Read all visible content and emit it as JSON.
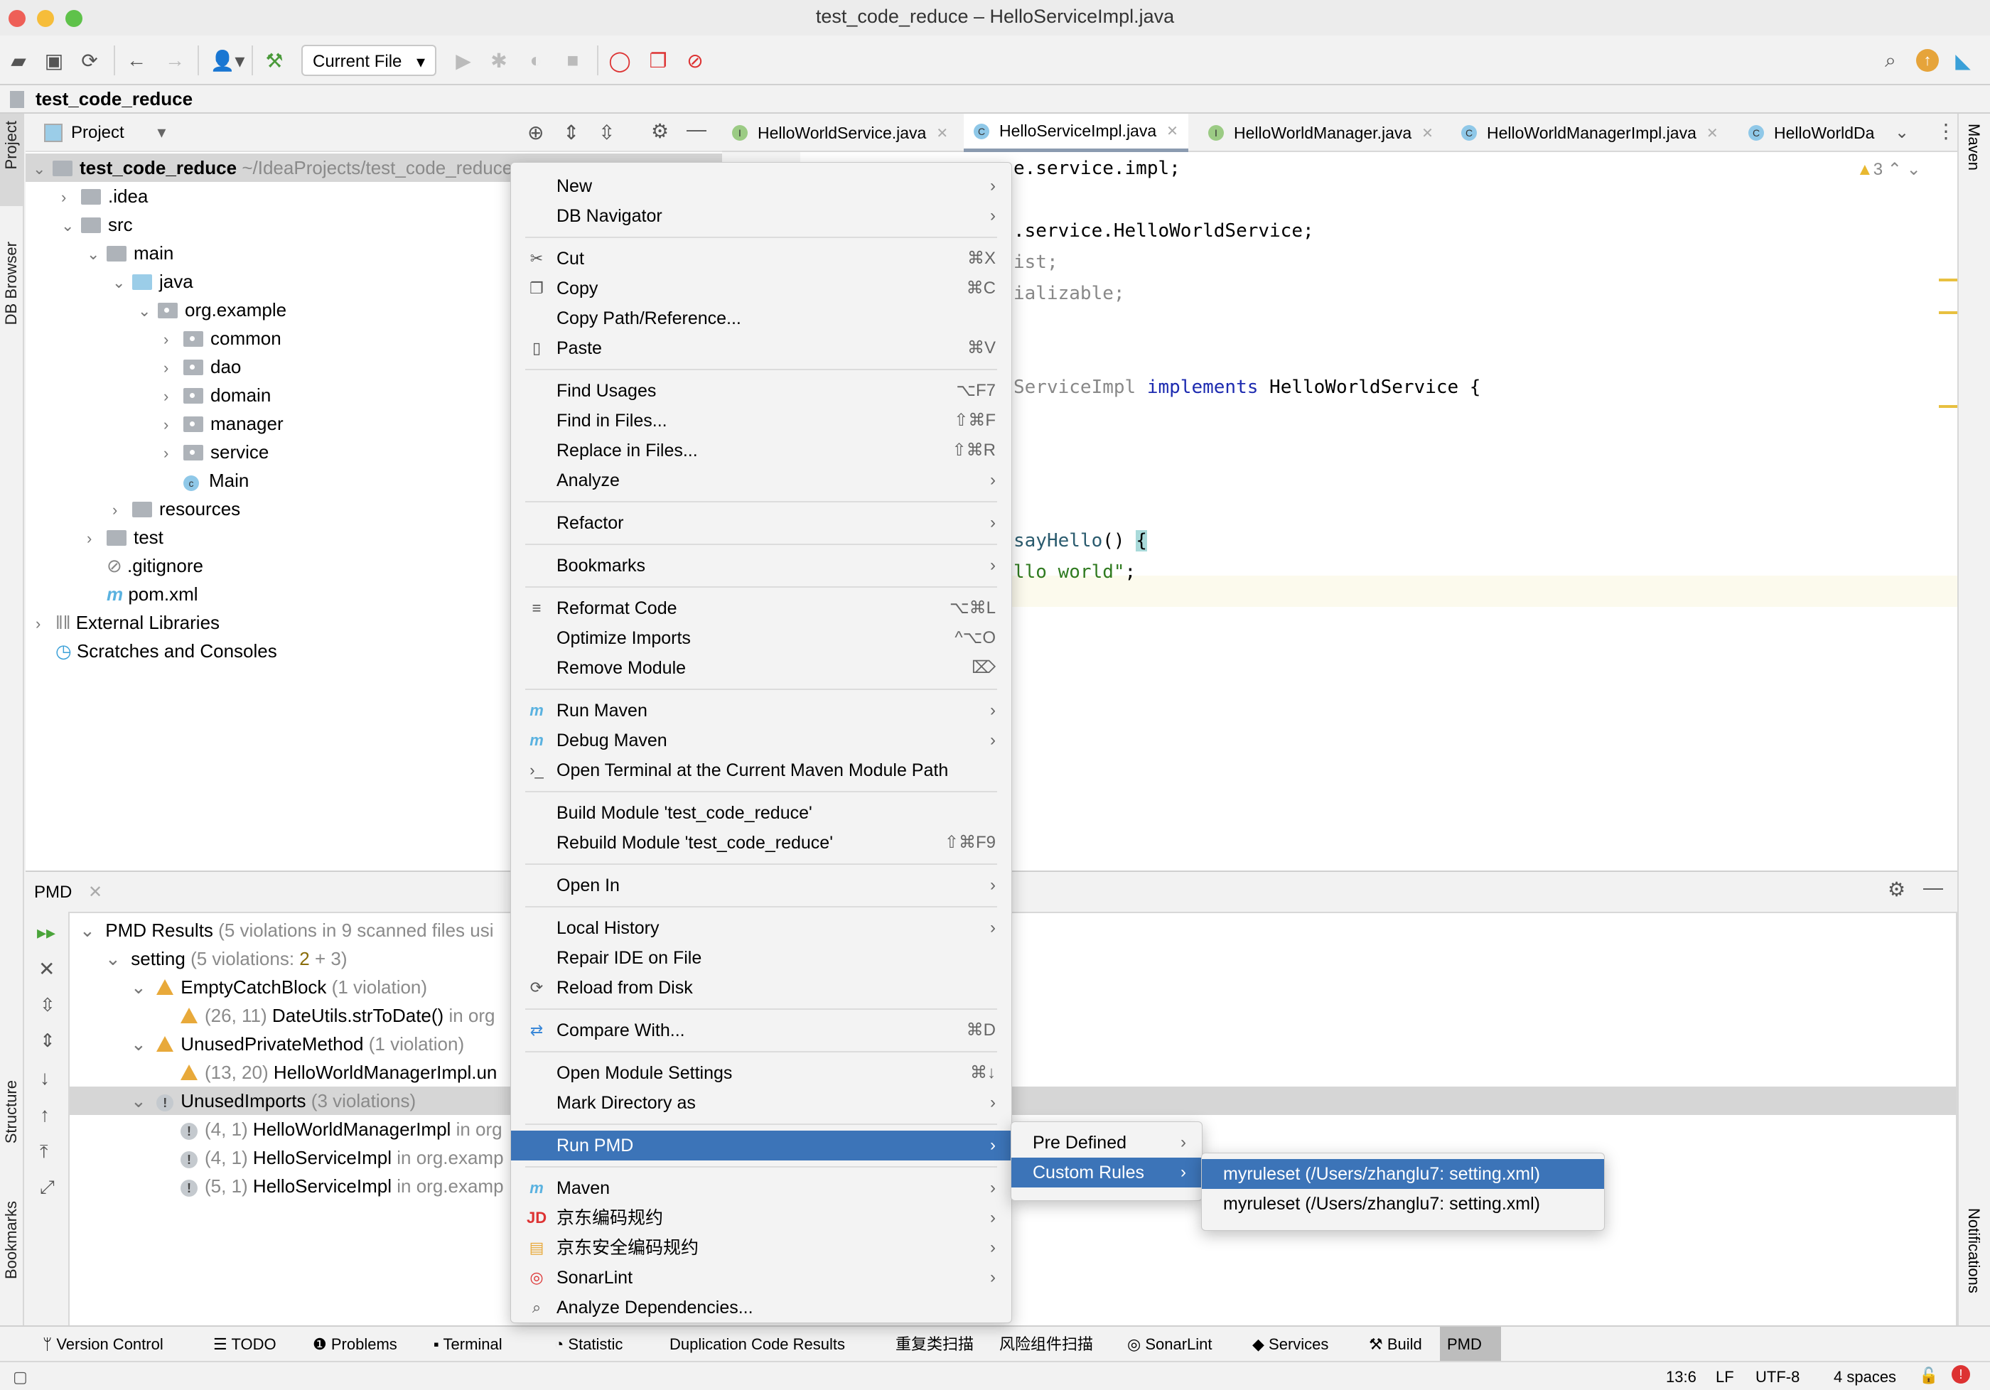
{
  "window": {
    "title": "test_code_reduce – HelloServiceImpl.java"
  },
  "toolbar": {
    "run_config": "Current File"
  },
  "navbar": {
    "project": "test_code_reduce"
  },
  "left_strip": {
    "project": "Project",
    "db_browser": "DB Browser",
    "structure": "Structure",
    "bookmarks": "Bookmarks"
  },
  "right_strip": {
    "maven": "Maven",
    "notifications": "Notifications"
  },
  "project_panel": {
    "title": "Project",
    "tree": [
      {
        "label": "test_code_reduce",
        "hint": "~/IdeaProjects/test_code_reduce"
      },
      {
        "label": ".idea"
      },
      {
        "label": "src"
      },
      {
        "label": "main"
      },
      {
        "label": "java"
      },
      {
        "label": "org.example"
      },
      {
        "label": "common"
      },
      {
        "label": "dao"
      },
      {
        "label": "domain"
      },
      {
        "label": "manager"
      },
      {
        "label": "service"
      },
      {
        "label": "Main"
      },
      {
        "label": "resources"
      },
      {
        "label": "test"
      },
      {
        "label": ".gitignore"
      },
      {
        "label": "pom.xml"
      },
      {
        "label": "External Libraries"
      },
      {
        "label": "Scratches and Consoles"
      }
    ]
  },
  "editor": {
    "tabs": [
      {
        "label": "HelloWorldService.java",
        "kind": "I"
      },
      {
        "label": "HelloServiceImpl.java",
        "kind": "C"
      },
      {
        "label": "HelloWorldManager.java",
        "kind": "I"
      },
      {
        "label": "HelloWorldManagerImpl.java",
        "kind": "C"
      },
      {
        "label": "HelloWorldDa",
        "kind": "C"
      }
    ],
    "warning_count": "3",
    "code_lines": [
      "package org.example.service.impl;",
      "import org.example.service.HelloWorldService;",
      "import java.util.List;",
      "import java.io.Serializable;",
      "public class HelloServiceImpl implements HelloWorldService {",
      "    public String sayHello() {",
      "        return \"hello world\";"
    ],
    "visible_fragments": {
      "l1": "e.service.impl;",
      "l2": ".service.HelloWorldService;",
      "l3": "ist;",
      "l4": "ializable;",
      "l5a": "ServiceImpl ",
      "l5b": "implements",
      "l5c": " HelloWorldService {",
      "l6a": "sayHello",
      "l6b": "() ",
      "l6c": "{",
      "l7a": "llo world\"",
      "l7b": ";"
    }
  },
  "pmd": {
    "tab": "PMD",
    "rows": [
      {
        "label": "PMD Results",
        "detail": "(5 violations in 9 scanned files usi"
      },
      {
        "label": "setting",
        "detail_a": "(5 violations: ",
        "detail_b": "2",
        "detail_c": " + 3)"
      },
      {
        "label": "EmptyCatchBlock",
        "detail": "(1 violation)",
        "icon": "warning"
      },
      {
        "pos": "(26, 11)",
        "label": "DateUtils.strToDate()",
        "detail": "in org",
        "icon": "warning"
      },
      {
        "label": "UnusedPrivateMethod",
        "detail": "(1 violation)",
        "icon": "warning"
      },
      {
        "pos": "(13, 20)",
        "label": "HelloWorldManagerImpl.un",
        "icon": "warning"
      },
      {
        "label": "UnusedImports",
        "detail": "(3 violations)",
        "icon": "info"
      },
      {
        "pos": "(4, 1)",
        "label": "HelloWorldManagerImpl",
        "detail": "in org",
        "icon": "info"
      },
      {
        "pos": "(4, 1)",
        "label": "HelloServiceImpl",
        "detail": "in org.examp",
        "icon": "info"
      },
      {
        "pos": "(5, 1)",
        "label": "HelloServiceImpl",
        "detail": "in org.examp",
        "icon": "info"
      }
    ]
  },
  "context_menu": {
    "items": [
      {
        "label": "New",
        "submenu": true
      },
      {
        "label": "DB Navigator",
        "submenu": true
      },
      {
        "label": "Cut",
        "shortcut": "⌘X",
        "icon": "✂"
      },
      {
        "label": "Copy",
        "shortcut": "⌘C",
        "icon": "❐"
      },
      {
        "label": "Copy Path/Reference..."
      },
      {
        "label": "Paste",
        "shortcut": "⌘V",
        "icon": "▯"
      },
      {
        "label": "Find Usages",
        "shortcut": "⌥F7"
      },
      {
        "label": "Find in Files...",
        "shortcut": "⇧⌘F"
      },
      {
        "label": "Replace in Files...",
        "shortcut": "⇧⌘R"
      },
      {
        "label": "Analyze",
        "submenu": true
      },
      {
        "label": "Refactor",
        "submenu": true
      },
      {
        "label": "Bookmarks",
        "submenu": true
      },
      {
        "label": "Reformat Code",
        "shortcut": "⌥⌘L",
        "icon": "≡"
      },
      {
        "label": "Optimize Imports",
        "shortcut": "^⌥O"
      },
      {
        "label": "Remove Module",
        "shortcut": "⌦"
      },
      {
        "label": "Run Maven",
        "submenu": true,
        "icon": "m"
      },
      {
        "label": "Debug Maven",
        "submenu": true,
        "icon": "m"
      },
      {
        "label": "Open Terminal at the Current Maven Module Path",
        "icon": "›_"
      },
      {
        "label": "Build Module 'test_code_reduce'"
      },
      {
        "label": "Rebuild Module 'test_code_reduce'",
        "shortcut": "⇧⌘F9"
      },
      {
        "label": "Open In",
        "submenu": true
      },
      {
        "label": "Local History",
        "submenu": true
      },
      {
        "label": "Repair IDE on File"
      },
      {
        "label": "Reload from Disk",
        "icon": "⟳"
      },
      {
        "label": "Compare With...",
        "shortcut": "⌘D",
        "icon": "⇄"
      },
      {
        "label": "Open Module Settings",
        "shortcut": "⌘↓"
      },
      {
        "label": "Mark Directory as",
        "submenu": true
      },
      {
        "label": "Run PMD",
        "submenu": true,
        "selected": true
      },
      {
        "label": "Maven",
        "submenu": true,
        "icon": "m"
      },
      {
        "label": "京东编码规约",
        "submenu": true,
        "icon": "JD"
      },
      {
        "label": "京东安全编码规约",
        "submenu": true,
        "icon": "▤"
      },
      {
        "label": "SonarLint",
        "submenu": true,
        "icon": "◎"
      },
      {
        "label": "Analyze Dependencies...",
        "icon": "⌕"
      }
    ]
  },
  "pmd_submenu": {
    "items": [
      {
        "label": "Pre Defined"
      },
      {
        "label": "Custom Rules",
        "selected": true
      }
    ]
  },
  "custom_rules_submenu": {
    "items": [
      {
        "label": "myruleset (/Users/zhanglu7: setting.xml)",
        "selected": true
      },
      {
        "label": "myruleset (/Users/zhanglu7: setting.xml)"
      }
    ]
  },
  "bottom_tabs": [
    "Version Control",
    "TODO",
    "Problems",
    "Terminal",
    "Statistic",
    "Duplication Code Results",
    "重复类扫描",
    "风险组件扫描",
    "SonarLint",
    "Services",
    "Build",
    "PMD"
  ],
  "status": {
    "position": "13:6",
    "line_sep": "LF",
    "encoding": "UTF-8",
    "indent": "4 spaces"
  },
  "colors": {
    "selection": "#3c74b8",
    "warning": "#e8a93a",
    "keyword": "#1d2bb0",
    "string": "#2f7a1f",
    "method": "#2a5b6e"
  }
}
